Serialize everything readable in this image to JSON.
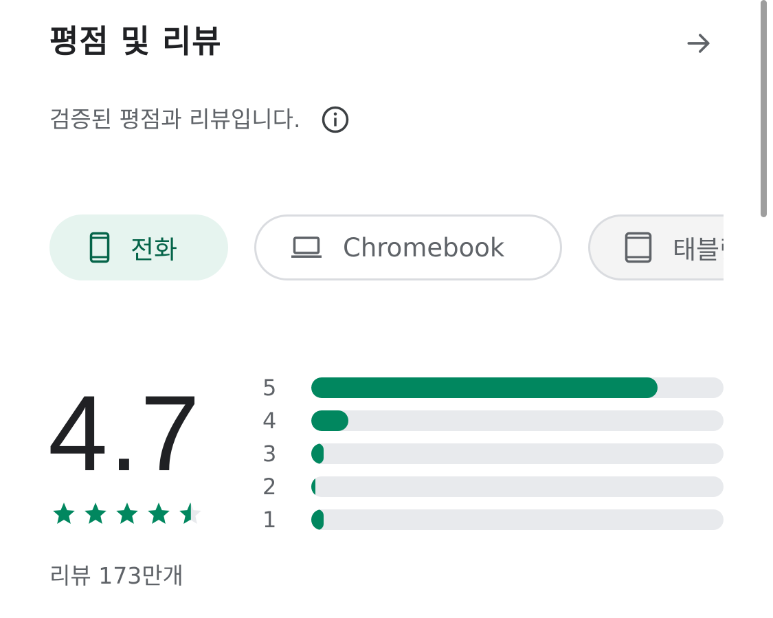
{
  "header": {
    "title": "평점 및 리뷰",
    "arrow_icon": "arrow-right-icon"
  },
  "subtitle": {
    "text": "검증된 평점과 리뷰입니다.",
    "info_icon": "info-icon"
  },
  "device_chips": [
    {
      "label": "전화",
      "icon": "phone-icon",
      "selected": true
    },
    {
      "label": "Chromebook",
      "icon": "laptop-icon",
      "selected": false
    },
    {
      "label": "태블릿",
      "icon": "tablet-icon",
      "selected": false
    }
  ],
  "rating": {
    "value": "4.7",
    "stars": 4.7,
    "review_count": "리뷰 173만개"
  },
  "distribution": [
    {
      "label": "5",
      "fraction": 0.84
    },
    {
      "label": "4",
      "fraction": 0.09
    },
    {
      "label": "3",
      "fraction": 0.03
    },
    {
      "label": "2",
      "fraction": 0.01
    },
    {
      "label": "1",
      "fraction": 0.03
    }
  ],
  "colors": {
    "accent": "#01875f",
    "chip_selected_bg": "#e6f4ef",
    "chip_selected_text": "#056449",
    "track": "#e8eaed",
    "muted_text": "#5f6368",
    "primary_text": "#202124"
  }
}
